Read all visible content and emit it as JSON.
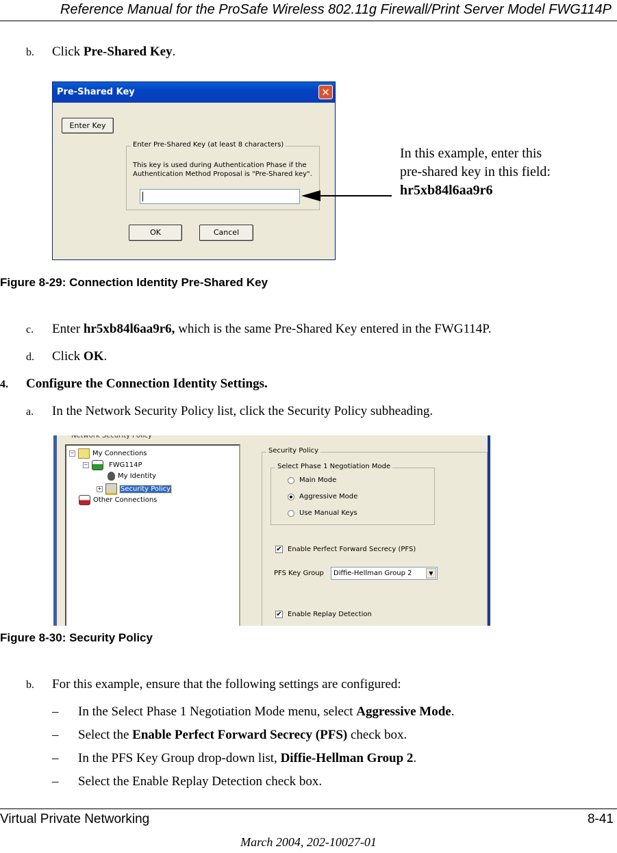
{
  "header": {
    "title": "Reference Manual for the ProSafe Wireless 802.11g  Firewall/Print Server Model FWG114P"
  },
  "steps": {
    "b1": {
      "marker": "b.",
      "text": "Click ",
      "bold": "Pre-Shared Key",
      "suffix": "."
    },
    "c": {
      "marker": "c.",
      "text": "Enter ",
      "bold": "hr5xb84l6aa9r6,",
      "suffix": " which is the same Pre-Shared Key entered in the FWG114P."
    },
    "d": {
      "marker": "d.",
      "text": "Click ",
      "bold": "OK",
      "suffix": "."
    },
    "s4": {
      "marker": "4.",
      "bold": "Configure the Connection Identity Settings."
    },
    "a": {
      "marker": "a.",
      "text": "In the Network Security Policy list, click the Security Policy subheading."
    },
    "b2": {
      "marker": "b.",
      "text": "For this example, ensure that the following settings are configured:"
    }
  },
  "bullets": [
    {
      "dash": "–",
      "text": "In the Select Phase 1 Negotiation Mode menu, select ",
      "bold": "Aggressive Mode",
      "suffix": "."
    },
    {
      "dash": "–",
      "text": "Select the ",
      "bold": "Enable Perfect Forward Secrecy (PFS)",
      "suffix": " check box."
    },
    {
      "dash": "–",
      "text": "In the PFS Key Group drop-down list, ",
      "bold": "Diffie-Hellman Group 2",
      "suffix": "."
    },
    {
      "dash": "–",
      "text": "Select the Enable Replay Detection check box.",
      "bold": "",
      "suffix": ""
    }
  ],
  "figure1": {
    "caption": "Figure 8-29:  Connection Identity Pre-Shared Key",
    "dialog": {
      "title": "Pre-Shared Key",
      "close": "✕",
      "enter_key_button": "Enter Key",
      "group_label": "Enter Pre-Shared Key (at least 8 characters)",
      "description_line1": "This key is used during Authentication Phase if the",
      "description_line2": "Authentication Method Proposal is \"Pre-Shared key\".",
      "key_value": "",
      "ok_button": "OK",
      "cancel_button": "Cancel"
    },
    "note": {
      "line1": "In this example, enter this",
      "line2": "pre-shared key in this field:",
      "key": "hr5xb84l6aa9r6"
    }
  },
  "figure2": {
    "caption": "Figure 8-30:  Security Policy",
    "tree_label": "Network Security Policy",
    "tree": [
      {
        "label": "My Connections",
        "expander": "−",
        "icon": "folder-icon"
      },
      {
        "label": "FWG114P",
        "expander": "−",
        "icon": "connection-icon"
      },
      {
        "label": "My Identity",
        "expander": "",
        "icon": "identity-icon"
      },
      {
        "label": "Security Policy",
        "expander": "+",
        "icon": "policy-folder-icon",
        "selected": true
      },
      {
        "label": "Other Connections",
        "expander": "",
        "icon": "other-connections-icon"
      }
    ],
    "policy_group": "Security Policy",
    "phase1_group": "Select Phase 1 Negotiation Mode",
    "modes": [
      {
        "label": "Main Mode",
        "selected": false
      },
      {
        "label": "Aggressive Mode",
        "selected": true
      },
      {
        "label": "Use Manual Keys",
        "selected": false
      }
    ],
    "pfs_checkbox": {
      "label": "Enable Perfect Forward Secrecy (PFS)",
      "checked": true,
      "mark": "✔"
    },
    "pfs_key_group_label": "PFS Key Group",
    "pfs_key_group_value": "Diffie-Hellman Group 2",
    "replay_checkbox": {
      "label": "Enable Replay Detection",
      "checked": true,
      "mark": "✔"
    }
  },
  "footer": {
    "section": "Virtual Private Networking",
    "page": "8-41",
    "date": "March 2004, 202-10027-01"
  }
}
